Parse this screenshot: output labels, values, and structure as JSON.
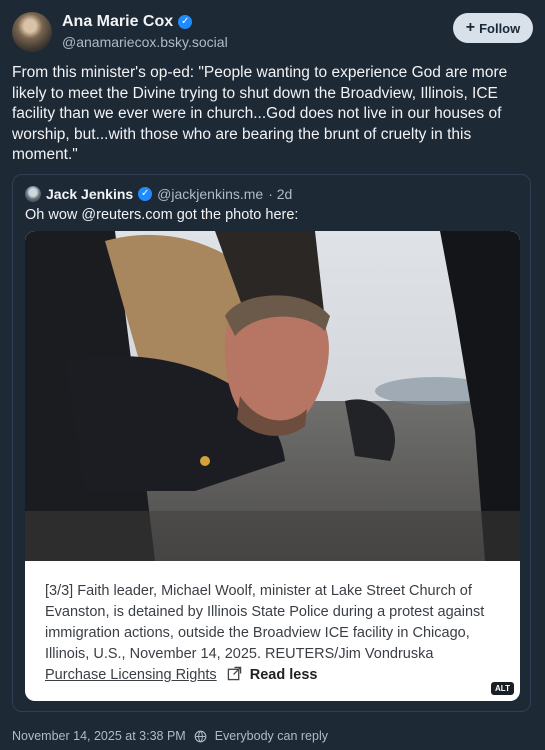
{
  "author": {
    "name": "Ana Marie Cox",
    "handle": "@anamariecox.bsky.social"
  },
  "follow_label": "Follow",
  "post_text": "From this minister's op-ed: \"People wanting to experience God are more likely to meet the Divine trying to shut down the Broadview, Illinois, ICE facility than we ever were in church...God does not live in our houses of worship, but...with those who are bearing the brunt of cruelty in this moment.\"",
  "quote": {
    "author_name": "Jack Jenkins",
    "handle": "@jackjenkins.me",
    "age": "· 2d",
    "text": "Oh wow @reuters.com got the photo here:",
    "caption": "[3/3] Faith leader, Michael Woolf, minister at Lake Street Church of Evanston, is detained by Illinois State Police during a protest against immigration actions, outside the Broadview ICE facility in Chicago, Illinois, U.S., November 14, 2025. REUTERS/Jim Vondruska",
    "caption_link": "Purchase Licensing Rights",
    "read_less": "Read less",
    "alt_badge": "ALT"
  },
  "footer": {
    "timestamp": "November 14, 2025 at 3:38 PM",
    "reply_setting": "Everybody can reply"
  },
  "colors": {
    "background": "#1e2936",
    "verified": "#208bfe",
    "follow_button": "#d8e1ea"
  },
  "icons": [
    "verified-icon",
    "plus-icon",
    "external-link-icon",
    "reply-setting-icon"
  ]
}
